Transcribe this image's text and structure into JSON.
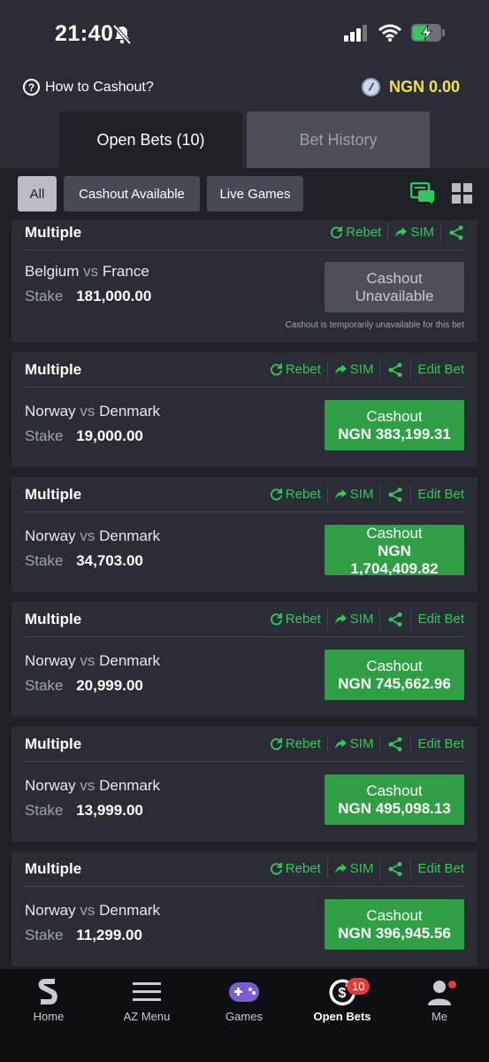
{
  "status_bar": {
    "time": "21:40"
  },
  "header": {
    "how_to_cashout": "How to Cashout?",
    "balance": "NGN 0.00",
    "tabs": [
      {
        "label": "Open Bets (10)",
        "active": true
      },
      {
        "label": "Bet History",
        "active": false
      }
    ]
  },
  "filters": {
    "items": [
      "All",
      "Cashout Available",
      "Live Games"
    ],
    "selected": "All"
  },
  "actions": {
    "rebet": "Rebet",
    "sim": "SIM",
    "edit": "Edit Bet"
  },
  "bets": [
    {
      "type": "Multiple",
      "home": "Belgium",
      "vs": "vs",
      "away": "France",
      "stake_label": "Stake",
      "stake": "181,000.00",
      "cashout_line1": "Cashout",
      "cashout_line2": "Unavailable",
      "note": "Cashout is temporarily unavailable for this bet",
      "available": false
    },
    {
      "type": "Multiple",
      "home": "Norway",
      "vs": "vs",
      "away": "Denmark",
      "stake_label": "Stake",
      "stake": "19,000.00",
      "cashout_line1": "Cashout",
      "cashout_line2": "NGN 383,199.31",
      "available": true
    },
    {
      "type": "Multiple",
      "home": "Norway",
      "vs": "vs",
      "away": "Denmark",
      "stake_label": "Stake",
      "stake": "34,703.00",
      "cashout_line1": "Cashout",
      "cashout_line2": "NGN",
      "cashout_line3": "1,704,409.82",
      "available": true
    },
    {
      "type": "Multiple",
      "home": "Norway",
      "vs": "vs",
      "away": "Denmark",
      "stake_label": "Stake",
      "stake": "20,999.00",
      "cashout_line1": "Cashout",
      "cashout_line2": "NGN 745,662.96",
      "available": true
    },
    {
      "type": "Multiple",
      "home": "Norway",
      "vs": "vs",
      "away": "Denmark",
      "stake_label": "Stake",
      "stake": "13,999.00",
      "cashout_line1": "Cashout",
      "cashout_line2": "NGN 495,098.13",
      "available": true
    },
    {
      "type": "Multiple",
      "home": "Norway",
      "vs": "vs",
      "away": "Denmark",
      "stake_label": "Stake",
      "stake": "11,299.00",
      "cashout_line1": "Cashout",
      "cashout_line2": "NGN 396,945.56",
      "available": true
    }
  ],
  "bottom_nav": {
    "items": [
      {
        "label": "Home",
        "icon": "sporty-logo-icon"
      },
      {
        "label": "AZ Menu",
        "icon": "menu-icon"
      },
      {
        "label": "Games",
        "icon": "gamepad-icon"
      },
      {
        "label": "Open Bets",
        "icon": "cashout-icon",
        "badge": "10",
        "active": true
      },
      {
        "label": "Me",
        "icon": "user-icon",
        "dot": true
      }
    ]
  },
  "colors": {
    "accent_green": "#34c759",
    "cashout_green": "#2f9e44",
    "balance_yellow": "#f2e14a",
    "badge_red": "#e53935"
  }
}
